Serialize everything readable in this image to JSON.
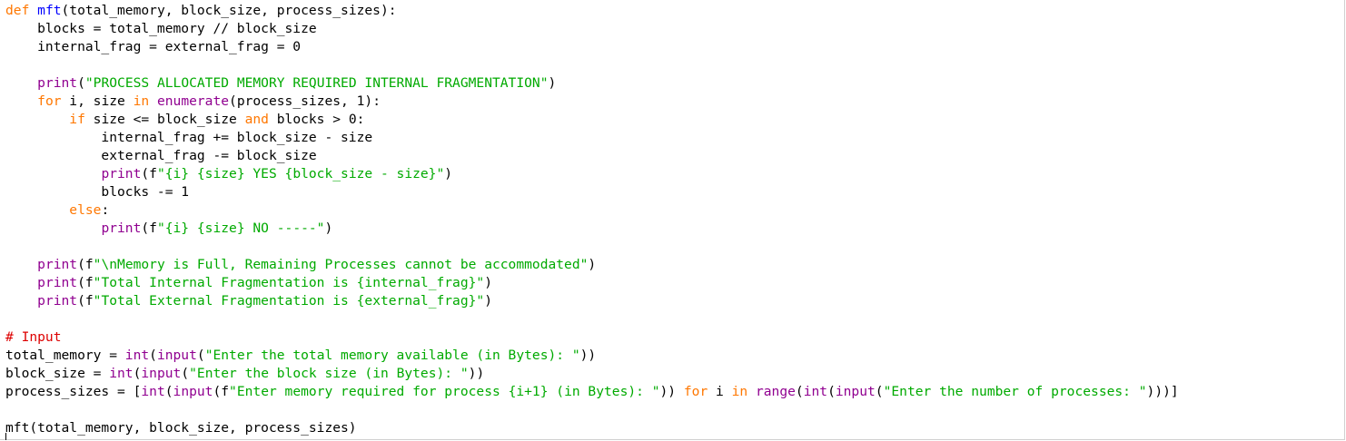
{
  "editor": {
    "colors": {
      "keyword": "#ff7700",
      "builtin": "#900090",
      "string": "#00aa00",
      "comment": "#dd0000",
      "definition": "#0000ff",
      "text": "#000000"
    },
    "lines": [
      [
        [
          "kw",
          "def"
        ],
        [
          "tx",
          " "
        ],
        [
          "df",
          "mft"
        ],
        [
          "tx",
          "(total_memory, block_size, process_sizes):"
        ]
      ],
      [
        [
          "tx",
          "    blocks = total_memory // block_size"
        ]
      ],
      [
        [
          "tx",
          "    internal_frag = external_frag = 0"
        ]
      ],
      [],
      [
        [
          "tx",
          "    "
        ],
        [
          "bi",
          "print"
        ],
        [
          "tx",
          "("
        ],
        [
          "st",
          "\"PROCESS ALLOCATED MEMORY REQUIRED INTERNAL FRAGMENTATION\""
        ],
        [
          "tx",
          ")"
        ]
      ],
      [
        [
          "tx",
          "    "
        ],
        [
          "kw",
          "for"
        ],
        [
          "tx",
          " i, size "
        ],
        [
          "kw",
          "in"
        ],
        [
          "tx",
          " "
        ],
        [
          "bi",
          "enumerate"
        ],
        [
          "tx",
          "(process_sizes, 1):"
        ]
      ],
      [
        [
          "tx",
          "        "
        ],
        [
          "kw",
          "if"
        ],
        [
          "tx",
          " size <= block_size "
        ],
        [
          "kw",
          "and"
        ],
        [
          "tx",
          " blocks > 0:"
        ]
      ],
      [
        [
          "tx",
          "            internal_frag += block_size - size"
        ]
      ],
      [
        [
          "tx",
          "            external_frag -= block_size"
        ]
      ],
      [
        [
          "tx",
          "            "
        ],
        [
          "bi",
          "print"
        ],
        [
          "tx",
          "(f"
        ],
        [
          "st",
          "\"{i} {size} YES {block_size - size}\""
        ],
        [
          "tx",
          ")"
        ]
      ],
      [
        [
          "tx",
          "            blocks -= 1"
        ]
      ],
      [
        [
          "tx",
          "        "
        ],
        [
          "kw",
          "else"
        ],
        [
          "tx",
          ":"
        ]
      ],
      [
        [
          "tx",
          "            "
        ],
        [
          "bi",
          "print"
        ],
        [
          "tx",
          "(f"
        ],
        [
          "st",
          "\"{i} {size} NO -----\""
        ],
        [
          "tx",
          ")"
        ]
      ],
      [],
      [
        [
          "tx",
          "    "
        ],
        [
          "bi",
          "print"
        ],
        [
          "tx",
          "(f"
        ],
        [
          "st",
          "\"\\nMemory is Full, Remaining Processes cannot be accommodated\""
        ],
        [
          "tx",
          ")"
        ]
      ],
      [
        [
          "tx",
          "    "
        ],
        [
          "bi",
          "print"
        ],
        [
          "tx",
          "(f"
        ],
        [
          "st",
          "\"Total Internal Fragmentation is {internal_frag}\""
        ],
        [
          "tx",
          ")"
        ]
      ],
      [
        [
          "tx",
          "    "
        ],
        [
          "bi",
          "print"
        ],
        [
          "tx",
          "(f"
        ],
        [
          "st",
          "\"Total External Fragmentation is {external_frag}\""
        ],
        [
          "tx",
          ")"
        ]
      ],
      [],
      [
        [
          "cm",
          "# Input"
        ]
      ],
      [
        [
          "tx",
          "total_memory = "
        ],
        [
          "bi",
          "int"
        ],
        [
          "tx",
          "("
        ],
        [
          "bi",
          "input"
        ],
        [
          "tx",
          "("
        ],
        [
          "st",
          "\"Enter the total memory available (in Bytes): \""
        ],
        [
          "tx",
          "))"
        ]
      ],
      [
        [
          "tx",
          "block_size = "
        ],
        [
          "bi",
          "int"
        ],
        [
          "tx",
          "("
        ],
        [
          "bi",
          "input"
        ],
        [
          "tx",
          "("
        ],
        [
          "st",
          "\"Enter the block size (in Bytes): \""
        ],
        [
          "tx",
          "))"
        ]
      ],
      [
        [
          "tx",
          "process_sizes = ["
        ],
        [
          "bi",
          "int"
        ],
        [
          "tx",
          "("
        ],
        [
          "bi",
          "input"
        ],
        [
          "tx",
          "(f"
        ],
        [
          "st",
          "\"Enter memory required for process {i+1} (in Bytes): \""
        ],
        [
          "tx",
          ")) "
        ],
        [
          "kw",
          "for"
        ],
        [
          "tx",
          " i "
        ],
        [
          "kw",
          "in"
        ],
        [
          "tx",
          " "
        ],
        [
          "bi",
          "range"
        ],
        [
          "tx",
          "("
        ],
        [
          "bi",
          "int"
        ],
        [
          "tx",
          "("
        ],
        [
          "bi",
          "input"
        ],
        [
          "tx",
          "("
        ],
        [
          "st",
          "\"Enter the number of processes: \""
        ],
        [
          "tx",
          ")))]"
        ]
      ],
      [],
      [
        [
          "tx",
          "mft(total_memory, block_size, process_sizes)"
        ]
      ]
    ]
  }
}
